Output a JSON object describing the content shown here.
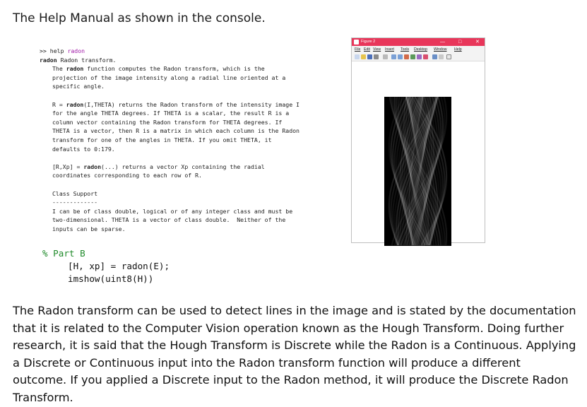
{
  "heading": "The Help Manual as shown in the console.",
  "console": {
    "prompt": ">> ",
    "command": "help",
    "command_arg": "radon",
    "lines": [
      {
        "indent": false,
        "bold": "radon",
        "text": " Radon transform."
      },
      {
        "indent": true,
        "pre": "The ",
        "bold": "radon",
        "text": " function computes the Radon transform, which is the"
      },
      {
        "indent": true,
        "text": "projection of the image intensity along a radial line oriented at a"
      },
      {
        "indent": true,
        "text": "specific angle."
      },
      {
        "gap": true
      },
      {
        "indent": true,
        "pre": "R = ",
        "bold": "radon",
        "text": "(I,THETA) returns the Radon transform of the intensity image I"
      },
      {
        "indent": true,
        "text": "for the angle THETA degrees. If THETA is a scalar, the result R is a"
      },
      {
        "indent": true,
        "text": "column vector containing the Radon transform for THETA degrees. If"
      },
      {
        "indent": true,
        "text": "THETA is a vector, then R is a matrix in which each column is the Radon"
      },
      {
        "indent": true,
        "text": "transform for one of the angles in THETA. If you omit THETA, it"
      },
      {
        "indent": true,
        "text": "defaults to 0:179."
      },
      {
        "gap": true
      },
      {
        "indent": true,
        "pre": "[R,Xp] = ",
        "bold": "radon",
        "text": "(...) returns a vector Xp containing the radial"
      },
      {
        "indent": true,
        "text": "coordinates corresponding to each row of R."
      },
      {
        "gap": true
      },
      {
        "indent": true,
        "text": "Class Support"
      },
      {
        "indent": true,
        "text": "-------------"
      },
      {
        "indent": true,
        "text": "I can be of class double, logical or of any integer class and must be"
      },
      {
        "indent": true,
        "text": "two-dimensional. THETA is a vector of class double.  Neither of the"
      },
      {
        "indent": true,
        "text": "inputs can be sparse."
      }
    ]
  },
  "code": {
    "comment": "% Part B",
    "line1": "[H, xp] = radon(E);",
    "line2": "imshow(uint8(H))"
  },
  "figure": {
    "title": "Figure 2",
    "min_btn": "—",
    "max_btn": "□",
    "close_btn": "✕",
    "menus": [
      "File",
      "Edit",
      "View",
      "Insert",
      "Tools",
      "Desktop",
      "Window",
      "Help"
    ],
    "accent": "#e8365a"
  },
  "paragraph": "The Radon transform can be used to detect lines in the image and is stated by the documentation that it is related to the Computer Vision operation known as the Hough Transform. Doing further research, it is said that the Hough Transform is Discrete while the Radon is a Continuous. Applying a Discrete or Continuous input into the Radon transform function will produce a different outcome. If you applied a Discrete input to the Radon method, it will produce the Discrete Radon Transform."
}
